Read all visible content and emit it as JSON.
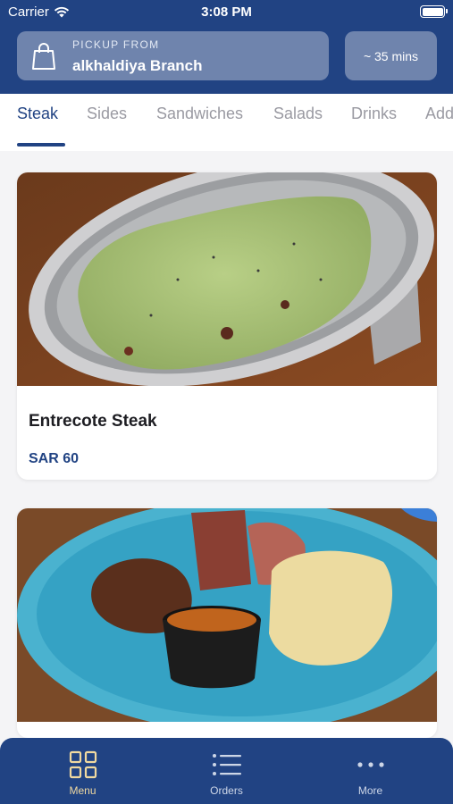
{
  "status_bar": {
    "carrier": "Carrier",
    "time": "3:08 PM"
  },
  "pickup": {
    "label": "PICKUP FROM",
    "branch": "alkhaldiya Branch"
  },
  "eta": "~ 35 mins",
  "categories": [
    "Steak",
    "Sides",
    "Sandwiches",
    "Salads",
    "Drinks",
    "Add"
  ],
  "active_category": "Steak",
  "items": [
    {
      "name": "Entrecote Steak",
      "price": "SAR 60"
    },
    {
      "name": "",
      "price": ""
    }
  ],
  "bottom_nav": [
    {
      "label": "Menu",
      "icon": "grid-icon",
      "active": true
    },
    {
      "label": "Orders",
      "icon": "list-icon",
      "active": false
    },
    {
      "label": "More",
      "icon": "more-dots-icon",
      "active": false
    }
  ],
  "colors": {
    "brand": "#214383",
    "active_nav": "#f0d9a0",
    "price": "#214383"
  }
}
